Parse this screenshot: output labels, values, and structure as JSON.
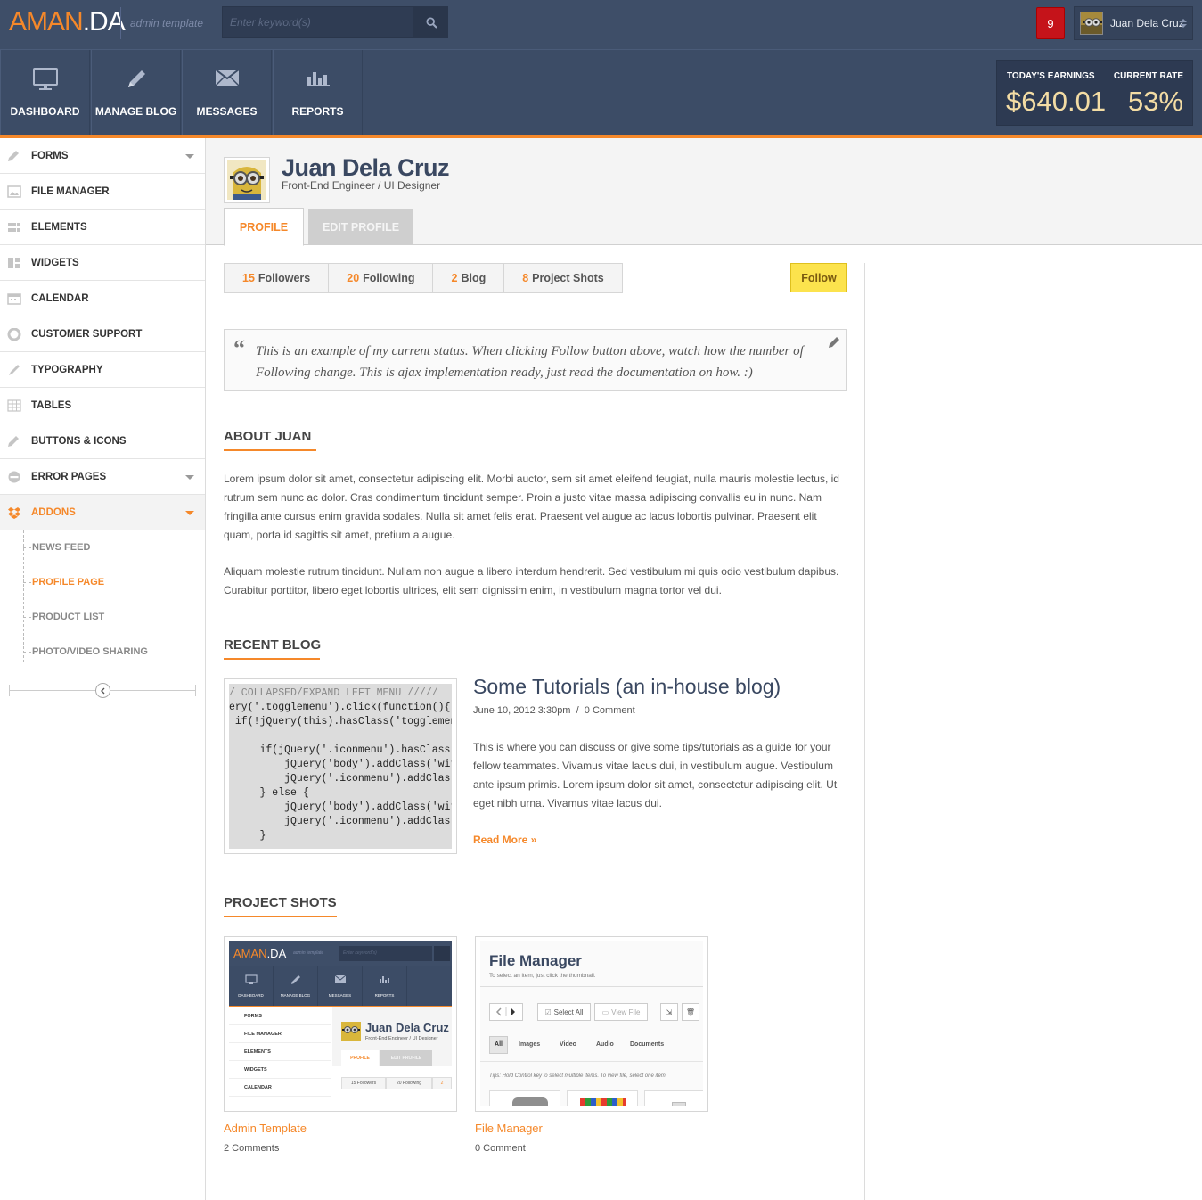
{
  "app": {
    "logo_primary": "AMAN",
    "logo_secondary": ".DA",
    "tagline": "admin template",
    "search_placeholder": "Enter keyword(s)",
    "notification_count": "9",
    "user_name": "Juan Dela Cruz"
  },
  "nav": {
    "items": [
      {
        "label": "DASHBOARD",
        "icon": "monitor-icon"
      },
      {
        "label": "MANAGE BLOG",
        "icon": "pencil-icon"
      },
      {
        "label": "MESSAGES",
        "icon": "envelope-icon"
      },
      {
        "label": "REPORTS",
        "icon": "bar-chart-icon"
      }
    ],
    "earnings_label": "TODAY'S EARNINGS",
    "earnings_value": "$640.01",
    "rate_label": "CURRENT RATE",
    "rate_value": "53%"
  },
  "sidebar": {
    "items": [
      {
        "label": "FORMS",
        "icon": "pencil-icon"
      },
      {
        "label": "FILE MANAGER",
        "icon": "image-icon"
      },
      {
        "label": "ELEMENTS",
        "icon": "grid-icon"
      },
      {
        "label": "WIDGETS",
        "icon": "widgets-icon"
      },
      {
        "label": "CALENDAR",
        "icon": "calendar-icon"
      },
      {
        "label": "CUSTOMER SUPPORT",
        "icon": "lifebuoy-icon"
      },
      {
        "label": "TYPOGRAPHY",
        "icon": "brush-icon"
      },
      {
        "label": "TABLES",
        "icon": "table-icon"
      },
      {
        "label": "BUTTONS & ICONS",
        "icon": "pencil-icon"
      },
      {
        "label": "ERROR PAGES",
        "icon": "no-entry-icon"
      },
      {
        "label": "ADDONS",
        "icon": "dropbox-icon"
      }
    ],
    "subitems": [
      {
        "label": "NEWS FEED"
      },
      {
        "label": "PROFILE PAGE"
      },
      {
        "label": "PRODUCT LIST"
      },
      {
        "label": "PHOTO/VIDEO SHARING"
      }
    ]
  },
  "profile": {
    "name": "Juan Dela Cruz",
    "title": "Front-End Engineer / UI Designer",
    "tabs": [
      {
        "label": "PROFILE"
      },
      {
        "label": "EDIT PROFILE"
      }
    ],
    "stats": [
      {
        "count": "15",
        "label": "Followers"
      },
      {
        "count": "20",
        "label": "Following"
      },
      {
        "count": "2",
        "label": "Blog"
      },
      {
        "count": "8",
        "label": "Project Shots"
      }
    ],
    "follow_label": "Follow",
    "status_quote": "“",
    "status": "This is an example of my current status. When clicking Follow button above, watch how the number of Following change. This is ajax implementation ready, just read the documentation on how. :)"
  },
  "about": {
    "title": "ABOUT JUAN",
    "p1": "Lorem ipsum dolor sit amet, consectetur adipiscing elit. Morbi auctor, sem sit amet eleifend feugiat, nulla mauris molestie lectus, id rutrum sem nunc ac dolor. Cras condimentum tincidunt semper. Proin a justo vitae massa adipiscing convallis eu in nunc. Nam fringilla ante cursus enim gravida sodales. Nulla sit amet felis erat. Praesent vel augue ac lacus lobortis pulvinar. Praesent elit quam, porta id sagittis sit amet, pretium a augue.",
    "p2": "Aliquam molestie rutrum tincidunt. Nullam non augue a libero interdum hendrerit. Sed vestibulum mi quis odio vestibulum dapibus. Curabitur porttitor, libero eget lobortis ultrices, elit sem dignissim enim, in vestibulum magna tortor vel dui."
  },
  "blog": {
    "section_title": "RECENT BLOG",
    "code_lines": [
      "/ COLLAPSED/EXPAND LEFT MENU /////",
      "ery('.togglemenu').click(function(){",
      " if(!jQuery(this).hasClass('togglemen",
      "",
      "     if(jQuery('.iconmenu').hasClass",
      "         jQuery('body').addClass('wit",
      "         jQuery('.iconmenu').addClas",
      "     } else {",
      "         jQuery('body').addClass('wit",
      "         jQuery('.iconmenu').addClas",
      "     }"
    ],
    "post_title": "Some Tutorials (an in-house blog)",
    "post_date": "June 10, 2012 3:30pm",
    "post_sep": "/",
    "post_comments": "0 Comment",
    "post_excerpt": "This is where you can discuss or give some tips/tutorials as a guide for your fellow teammates. Vivamus vitae lacus dui, in vestibulum augue. Vestibulum ante ipsum primis. Lorem ipsum dolor sit amet, consectetur adipiscing elit. Ut eget nibh urna. Vivamus vitae lacus dui.",
    "read_more": "Read More »"
  },
  "shots": {
    "section_title": "PROJECT SHOTS",
    "items": [
      {
        "title": "Admin Template",
        "comments": "2 Comments"
      },
      {
        "title": "File Manager",
        "comments": "0 Comment"
      }
    ],
    "mini_admin": {
      "logo_primary": "AMAN",
      "logo_secondary": ".DA",
      "tagline": "admin template",
      "search": "Enter keyword(s)",
      "nav": [
        "DASHBOARD",
        "MANAGE BLOG",
        "MESSAGES",
        "REPORTS"
      ],
      "side": [
        "FORMS",
        "FILE MANAGER",
        "ELEMENTS",
        "WIDGETS",
        "CALENDAR"
      ],
      "name": "Juan Dela Cruz",
      "title": "Front-End Engineer / UI Designer",
      "tab1": "PROFILE",
      "tab2": "EDIT PROFILE",
      "stat1": "15 Followers",
      "stat2": "20 Following",
      "stat3": "2"
    },
    "mini_fm": {
      "title": "File Manager",
      "subtitle": "To select an item, just click the thumbnail.",
      "select_all": "Select All",
      "view_file": "View File",
      "filters": [
        "All",
        "Images",
        "Video",
        "Audio",
        "Documents"
      ],
      "tip": "Tips: Hold Control key to select multiple items. To view file, select one item"
    }
  },
  "colors": {
    "accent": "#f5882a",
    "header": "#3e4e68",
    "notification": "#c5131a",
    "follow": "#fce34d"
  }
}
